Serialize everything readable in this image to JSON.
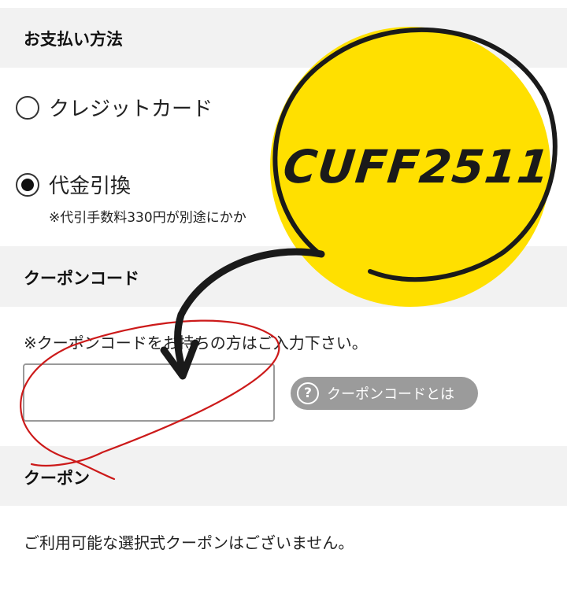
{
  "payment": {
    "heading": "お支払い方法",
    "options": [
      {
        "label": "クレジットカード",
        "selected": false
      },
      {
        "label": "代金引換",
        "selected": true
      }
    ],
    "cod_note": "※代引手数料330円が別途にかか"
  },
  "coupon_code": {
    "heading": "クーポンコード",
    "instruction": "※クーポンコードをお持ちの方はご入力下さい。",
    "input_value": "",
    "help_button_label": "クーポンコードとは",
    "help_icon_glyph": "?"
  },
  "coupons": {
    "heading": "クーポン",
    "message": "ご利用可能な選択式クーポンはございません。"
  },
  "sticker": {
    "code": "CUFF2511",
    "fill_color": "#ffe000",
    "stroke_color": "#1a1a1a"
  },
  "annotation_color": "#cc1a1a"
}
